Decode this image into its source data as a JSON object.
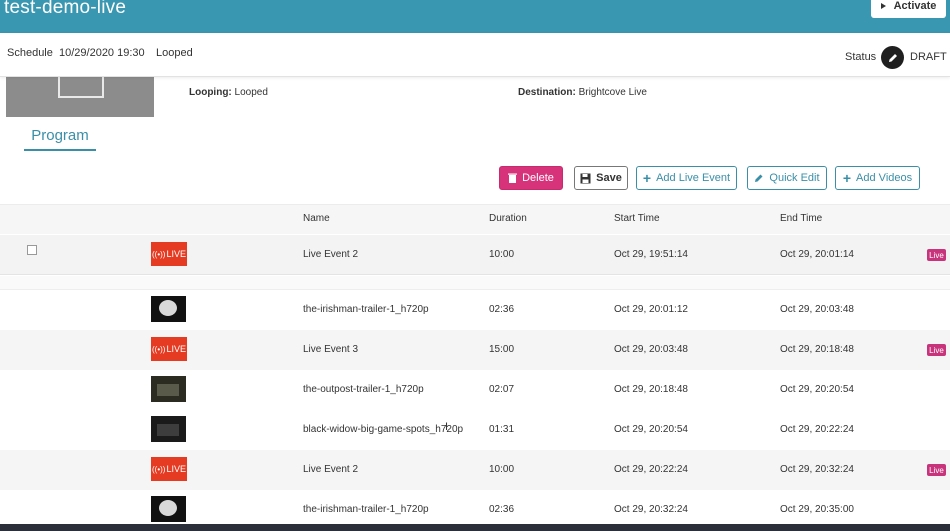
{
  "header": {
    "title": "test-demo-live",
    "activate_label": "Activate"
  },
  "schedule_bar": {
    "label": "Schedule",
    "datetime": "10/29/2020 19:30",
    "mode": "Looped",
    "status_label": "Status",
    "status_value": "DRAFT"
  },
  "details": {
    "looping_label": "Looping:",
    "looping_value": "Looped",
    "destination_label": "Destination:",
    "destination_value": "Brightcove Live"
  },
  "tabs": {
    "program": "Program"
  },
  "toolbar": {
    "delete": "Delete",
    "save": "Save",
    "add_live_event": "Add Live Event",
    "quick_edit": "Quick Edit",
    "add_videos": "Add Videos"
  },
  "table": {
    "headers": {
      "name": "Name",
      "duration": "Duration",
      "start_time": "Start Time",
      "end_time": "End Time"
    },
    "live_thumb_label": "LIVE",
    "rows": [
      {
        "type": "live",
        "name": "Live Event 2",
        "duration": "10:00",
        "start": "Oct 29, 19:51:14",
        "end": "Oct 29, 20:01:14",
        "badge": "Live"
      },
      {
        "type": "video",
        "name": "the-irishman-trailer-1_h720p",
        "duration": "02:36",
        "start": "Oct 29, 20:01:12",
        "end": "Oct 29, 20:03:48",
        "badge": ""
      },
      {
        "type": "live",
        "name": "Live Event 3",
        "duration": "15:00",
        "start": "Oct 29, 20:03:48",
        "end": "Oct 29, 20:18:48",
        "badge": "Live"
      },
      {
        "type": "video",
        "name": "the-outpost-trailer-1_h720p",
        "duration": "02:07",
        "start": "Oct 29, 20:18:48",
        "end": "Oct 29, 20:20:54",
        "badge": ""
      },
      {
        "type": "video",
        "name": "black-widow-big-game-spots_h720p",
        "duration": "01:31",
        "start": "Oct 29, 20:20:54",
        "end": "Oct 29, 20:22:24",
        "badge": ""
      },
      {
        "type": "live",
        "name": "Live Event 2",
        "duration": "10:00",
        "start": "Oct 29, 20:22:24",
        "end": "Oct 29, 20:32:24",
        "badge": "Live"
      },
      {
        "type": "video",
        "name": "the-irishman-trailer-1_h720p",
        "duration": "02:36",
        "start": "Oct 29, 20:32:24",
        "end": "Oct 29, 20:35:00",
        "badge": ""
      }
    ]
  },
  "colors": {
    "header_bg": "#3a97b1",
    "accent": "#3a8fa8",
    "delete_bg": "#d6337a",
    "live_thumb": "#e53b22",
    "live_badge": "#c8347c"
  }
}
